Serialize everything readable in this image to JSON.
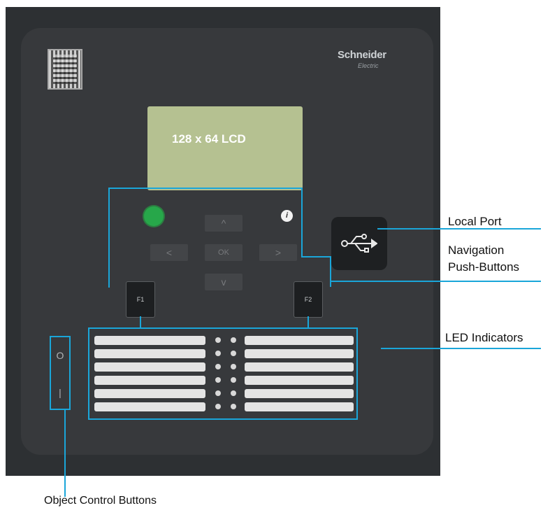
{
  "device": {
    "brand": "Schneider",
    "brand_sub": "Electric",
    "lcd_label": "128 x 64 LCD",
    "info_symbol": "i",
    "nav": {
      "up": "^",
      "left": "<",
      "ok": "OK",
      "right": ">",
      "down": "v"
    },
    "f1": "F1",
    "f2": "F2",
    "obj_open": "O",
    "obj_close": "|"
  },
  "callouts": {
    "local_port": "Local Port",
    "navigation_line1": "Navigation",
    "navigation_line2": "Push-Buttons",
    "led_indicators": "LED Indicators",
    "object_control": "Object Control Buttons"
  },
  "colors": {
    "callout": "#1aa6d9",
    "lcd": "#b5c191",
    "status_led": "#27a74a"
  }
}
